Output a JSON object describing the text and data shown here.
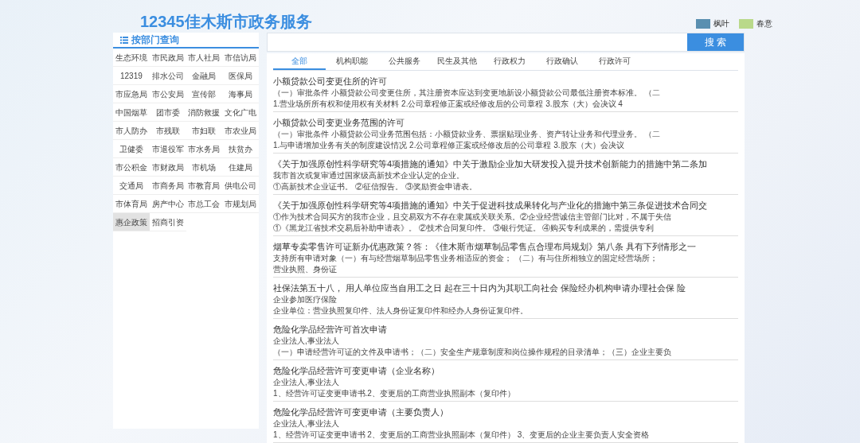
{
  "site_title": "12345佳木斯市政务服务",
  "skins": [
    {
      "label": "枫叶",
      "color": "#5a8fb0"
    },
    {
      "label": "春意",
      "color": "#b9d98a"
    }
  ],
  "sidebar": {
    "title": "按部门查询",
    "items": [
      {
        "label": "生态环境",
        "selected": false
      },
      {
        "label": "市民政局",
        "selected": false
      },
      {
        "label": "市人社局",
        "selected": false
      },
      {
        "label": "市信访局",
        "selected": false
      },
      {
        "label": "12319",
        "selected": false
      },
      {
        "label": "排水公司",
        "selected": false
      },
      {
        "label": "金融局",
        "selected": false
      },
      {
        "label": "医保局",
        "selected": false
      },
      {
        "label": "市应急局",
        "selected": false
      },
      {
        "label": "市公安局",
        "selected": false
      },
      {
        "label": "宣传部",
        "selected": false
      },
      {
        "label": "海事局",
        "selected": false
      },
      {
        "label": "中国烟草",
        "selected": false
      },
      {
        "label": "团市委",
        "selected": false
      },
      {
        "label": "消防救援",
        "selected": false
      },
      {
        "label": "文化广电",
        "selected": false
      },
      {
        "label": "市人防办",
        "selected": false
      },
      {
        "label": "市残联",
        "selected": false
      },
      {
        "label": "市妇联",
        "selected": false
      },
      {
        "label": "市农业局",
        "selected": false
      },
      {
        "label": "卫健委",
        "selected": false
      },
      {
        "label": "市退役军",
        "selected": false
      },
      {
        "label": "市水务局",
        "selected": false
      },
      {
        "label": "扶贫办",
        "selected": false
      },
      {
        "label": "市公积金",
        "selected": false
      },
      {
        "label": "市财政局",
        "selected": false
      },
      {
        "label": "市机场",
        "selected": false
      },
      {
        "label": "住建局",
        "selected": false
      },
      {
        "label": "交通局",
        "selected": false
      },
      {
        "label": "市商务局",
        "selected": false
      },
      {
        "label": "市教育局",
        "selected": false
      },
      {
        "label": "供电公司",
        "selected": false
      },
      {
        "label": "市体育局",
        "selected": false
      },
      {
        "label": "房产中心",
        "selected": false
      },
      {
        "label": "市总工会",
        "selected": false
      },
      {
        "label": "市规划局",
        "selected": false
      },
      {
        "label": "惠企政策",
        "selected": true
      },
      {
        "label": "招商引资",
        "selected": false
      }
    ]
  },
  "search": {
    "button": "搜 索"
  },
  "tabs": [
    {
      "label": "全部",
      "selected": true
    },
    {
      "label": "机构职能",
      "selected": false
    },
    {
      "label": "公共服务",
      "selected": false
    },
    {
      "label": "民生及其他",
      "selected": false
    },
    {
      "label": "行政权力",
      "selected": false
    },
    {
      "label": "行政确认",
      "selected": false
    },
    {
      "label": "行政许可",
      "selected": false
    }
  ],
  "results": [
    {
      "title": "小额贷款公司变更住所的许可",
      "lines": [
        "（一）审批条件 小额贷款公司变更住所，其注册资本应达到变更地新设小额贷款公司最低注册资本标准。 （二",
        "1.营业场所所有权和使用权有关材料 2.公司章程修正案或经修改后的公司章程 3.股东（大）会决议 4"
      ]
    },
    {
      "title": "小额贷款公司变更业务范围的许可",
      "lines": [
        "（一）审批条件 小额贷款公司业务范围包括：小额贷款业务、票据贴现业务、资产转让业务和代理业务。 （二",
        "1.与申请增加业务有关的制度建设情况 2.公司章程修正案或经修改后的公司章程 3.股东（大）会决议"
      ]
    },
    {
      "title": "《关于加强原创性科学研究等4项措施的通知》中关于激励企业加大研发投入提升技术创新能力的措施中第二条加",
      "lines": [
        "我市首次或复审通过国家级高新技术企业认定的企业。",
        "①高新技术企业证书。 ②征信报告。 ③奖励资金申请表。"
      ]
    },
    {
      "title": "《关于加强原创性科学研究等4项措施的通知》中关于促进科技成果转化与产业化的措施中第三条促进技术合同交",
      "lines": [
        "①作为技术合同买方的我市企业，且交易双方不存在隶属或关联关系。②企业经营诚信主管部门比对，不属于失信",
        "①《黑龙江省技术交易后补助申请表》。 ②技术合同复印件。 ③银行凭证。 ④购买专利成果的，需提供专利"
      ]
    },
    {
      "title": "烟草专卖零售许可证新办优惠政策？答：《佳木斯市烟草制品零售点合理布局规划》第八条 具有下列情形之一",
      "lines": [
        "支持所有申请对象（一）有与经营烟草制品零售业务相适应的资金； （二）有与住所相独立的固定经营场所；",
        "营业执照、身份证"
      ]
    },
    {
      "title": "社保法第五十八， 用人单位应当自用工之日 起在三十日内为其职工向社会 保险经办机构申请办理社会保 险",
      "lines": [
        "企业参加医疗保险",
        "企业单位：营业执照复印件、法人身份证复印件和经办人身份证复印件。"
      ]
    },
    {
      "title": "危险化学品经营许可首次申请",
      "lines": [
        "企业法人,事业法人",
        "（一）申请经营许可证的文件及申请书；（二）安全生产规章制度和岗位操作规程的目录清单；（三）企业主要负"
      ]
    },
    {
      "title": "危险化学品经营许可变更申请（企业名称）",
      "lines": [
        "企业法人,事业法人",
        "1、经营许可证变更申请书.2、变更后的工商营业执照副本（复印件）"
      ]
    },
    {
      "title": "危险化学品经营许可变更申请（主要负责人）",
      "lines": [
        "企业法人,事业法人",
        "1、经营许可证变更申请书 2、变更后的工商营业执照副本（复印件） 3、变更后的企业主要负责人安全资格"
      ]
    }
  ]
}
